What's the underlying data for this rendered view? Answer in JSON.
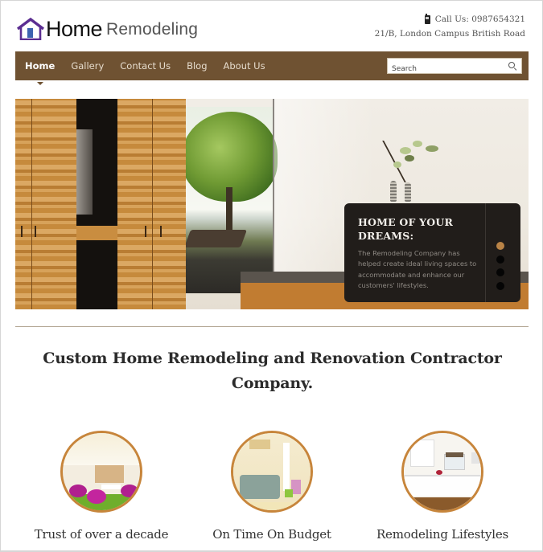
{
  "brand": {
    "logo_word_primary": "Home",
    "logo_word_secondary": "Remodeling",
    "logo_icon": "house-icon",
    "accent_color": "#6f5232",
    "logo_color": "#5b2d91"
  },
  "contact": {
    "phone_icon": "mobile-phone-icon",
    "phone_text": "Call Us: 0987654321",
    "address": "21/B, London Campus British Road"
  },
  "nav": {
    "items": [
      {
        "label": "Home",
        "active": true
      },
      {
        "label": "Gallery",
        "active": false
      },
      {
        "label": "Contact Us",
        "active": false
      },
      {
        "label": "Blog",
        "active": false
      },
      {
        "label": "About Us",
        "active": false
      }
    ],
    "search": {
      "placeholder": "Search",
      "value": "",
      "icon": "search-icon"
    }
  },
  "hero": {
    "image_alt": "Modern bedroom with wooden wardrobe and garden view",
    "caption_title": "HOME OF YOUR DREAMS:",
    "caption_body": "The Remodeling Company has helped create ideal living spaces to accommodate and enhance our customers' lifestyles.",
    "slides_total": 4,
    "active_slide": 1,
    "active_dot_color": "#b98346"
  },
  "headline": "Custom Home Remodeling and Renovation Contractor Company.",
  "features": [
    {
      "label": "Trust of over a decade",
      "image_alt": "Living room with pink chairs"
    },
    {
      "label": "On Time On Budget",
      "image_alt": "Armchair in bright room"
    },
    {
      "label": "Remodeling Lifestyles",
      "image_alt": "White kitchen"
    }
  ]
}
